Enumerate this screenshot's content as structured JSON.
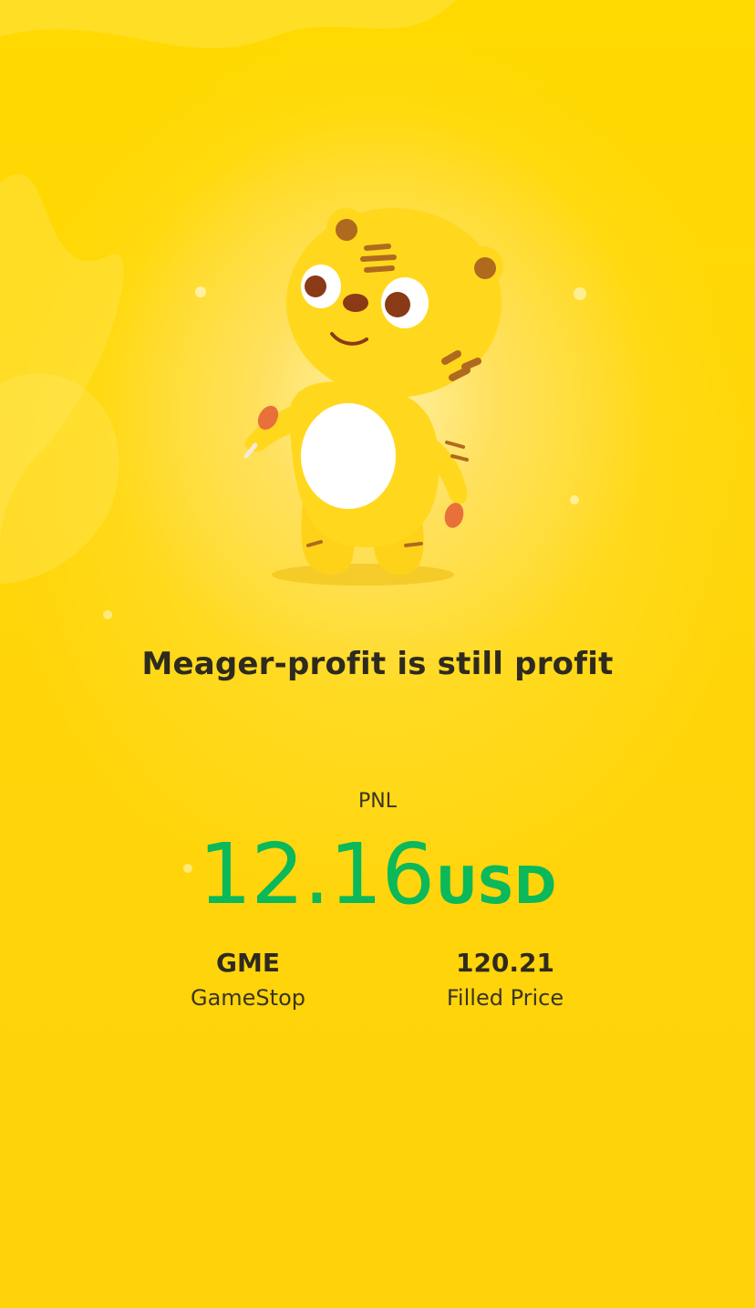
{
  "tagline": "Meager-profit is still profit",
  "pnl": {
    "label": "PNL",
    "value": "12.16",
    "unit": "USD"
  },
  "stock": {
    "symbol": "GME",
    "name": "GameStop"
  },
  "filled": {
    "price": "120.21",
    "label": "Filled Price"
  },
  "colors": {
    "background": "#FFD60A",
    "profit": "#0BB85A",
    "text": "#2E2A1E"
  },
  "mascot": {
    "icon": "tiger-mascot-icon"
  }
}
